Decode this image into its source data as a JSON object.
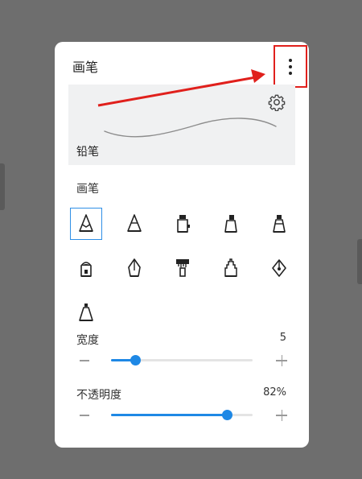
{
  "panel": {
    "title": "画笔",
    "more_icon": "more-vertical-icon"
  },
  "preview": {
    "label": "铅笔",
    "settings_icon": "gear-icon"
  },
  "brushes": {
    "label": "画笔",
    "selected_index": 0,
    "items": [
      {
        "icon": "pencil-icon"
      },
      {
        "icon": "cone-pen-icon"
      },
      {
        "icon": "ink-bottle-icon"
      },
      {
        "icon": "marker-icon"
      },
      {
        "icon": "highlighter-icon"
      },
      {
        "icon": "crayon-icon"
      },
      {
        "icon": "calligraphy-pen-icon"
      },
      {
        "icon": "paint-brush-icon"
      },
      {
        "icon": "pixel-pen-icon"
      },
      {
        "icon": "fountain-pen-icon"
      },
      {
        "icon": "cone-brush-icon"
      }
    ]
  },
  "width": {
    "label": "宽度",
    "value": "5",
    "fraction": 0.17
  },
  "opacity": {
    "label": "不透明度",
    "value": "82%",
    "fraction": 0.82
  },
  "colors": {
    "accent": "#1e88e5",
    "highlight_box": "#e0201c",
    "backdrop": "#6e6e6e"
  }
}
